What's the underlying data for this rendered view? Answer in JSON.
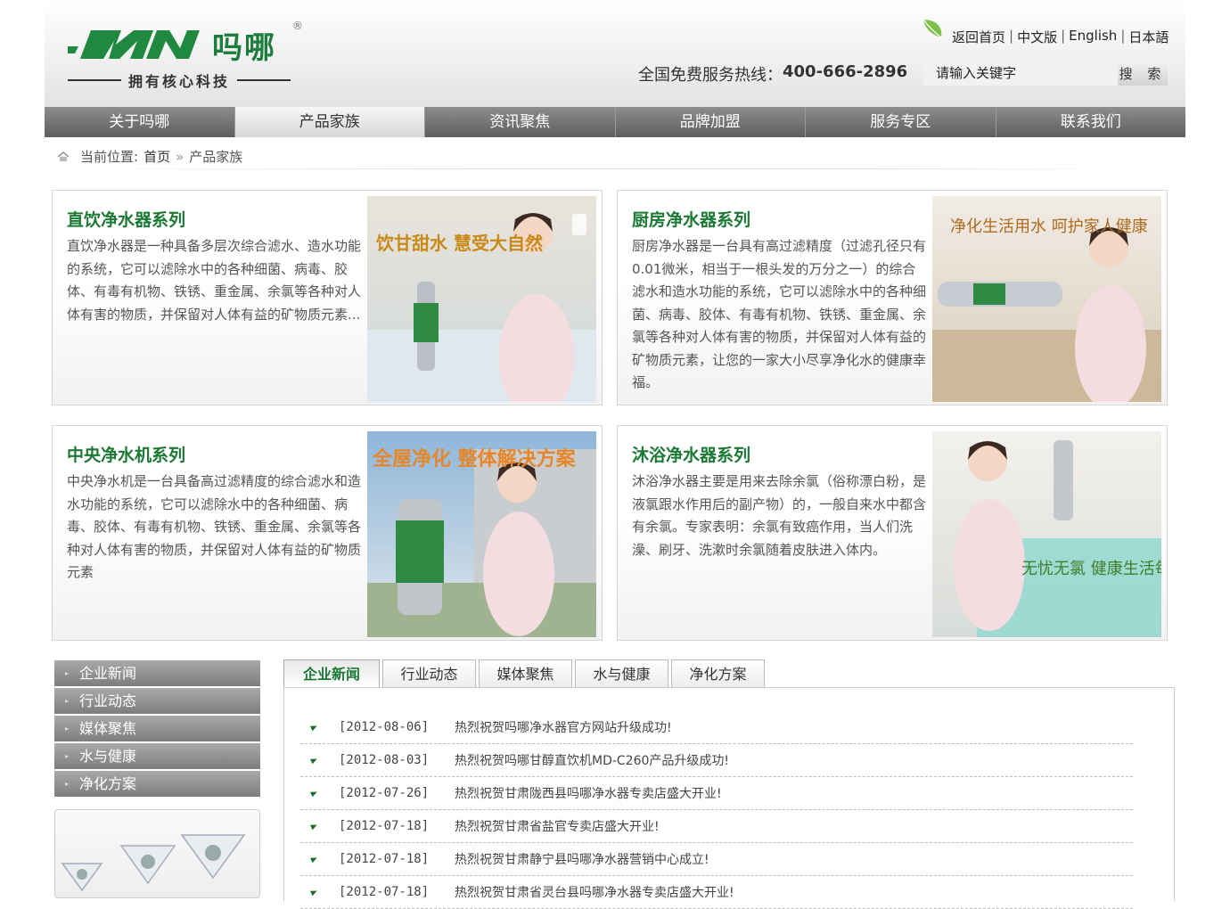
{
  "header": {
    "logo_cn": "吗哪",
    "logo_mark": "MN",
    "logo_reg": "®",
    "slogan": "拥有核心科技",
    "links": [
      "返回首页",
      "中文版",
      "English",
      "日本語"
    ],
    "hotline_label": "全国免费服务热线：",
    "hotline_number": "400-666-2896",
    "search_placeholder": "请输入关键字",
    "search_button": "搜 索"
  },
  "nav": [
    "关于吗哪",
    "产品家族",
    "资讯聚焦",
    "品牌加盟",
    "服务专区",
    "联系我们"
  ],
  "nav_active": 1,
  "breadcrumb": {
    "label": "当前位置:",
    "home": "首页",
    "separator": "»",
    "current": "产品家族"
  },
  "products": [
    {
      "title": "直饮净水器系列",
      "text": "直饮净水器是一种具备多层次综合滤水、造水功能的系统，它可以滤除水中的各种细菌、病毒、胶体、有毒有机物、铁锈、重金属、余氯等各种对人体有害的物质，并保留对人体有益的矿物质元素...",
      "img_text": "饮甘甜水 慧受大自然"
    },
    {
      "title": "厨房净水器系列",
      "text": "厨房净水器是一台具有高过滤精度（过滤孔径只有0.01微米，相当于一根头发的万分之一）的综合滤水和造水功能的系统，它可以滤除水中的各种细菌、病毒、胶体、有毒有机物、铁锈、重金属、余氯等各种对人体有害的物质，并保留对人体有益的矿物质元素，让您的一家大小尽享净化水的健康幸福。",
      "img_text": "净化生活用水 呵护家人健康"
    },
    {
      "title": "中央净水机系列",
      "text": "中央净水机是一台具备高过滤精度的综合滤水和造水功能的系统，它可以滤除水中的各种细菌、病毒、胶体、有毒有机物、铁锈、重金属、余氯等各种对人体有害的物质，并保留对人体有益的矿物质元素",
      "img_text": "全屋净化 整体解决方案"
    },
    {
      "title": "沐浴净水器系列",
      "text": "沐浴净水器主要是用来去除余氯（俗称漂白粉，是液氯跟水作用后的副产物）的，一般自来水中都含有余氯。专家表明：余氯有致癌作用，当人们洗澡、刷牙、洗漱时余氯随着皮肤进入体内。",
      "img_text": "无忧无氯 健康生活每一天！"
    }
  ],
  "side_menu": [
    "企业新闻",
    "行业动态",
    "媒体聚焦",
    "水与健康",
    "净化方案"
  ],
  "news_tabs": [
    "企业新闻",
    "行业动态",
    "媒体聚焦",
    "水与健康",
    "净化方案"
  ],
  "news_tab_active": 0,
  "news": [
    {
      "date": "[2012-08-06]",
      "title": "热烈祝贺吗哪净水器官方网站升级成功!"
    },
    {
      "date": "[2012-08-03]",
      "title": "热烈祝贺吗哪甘醇直饮机MD-C260产品升级成功!"
    },
    {
      "date": "[2012-07-26]",
      "title": "热烈祝贺甘肃陇西县吗哪净水器专卖店盛大开业!"
    },
    {
      "date": "[2012-07-18]",
      "title": "热烈祝贺甘肃省盐官专卖店盛大开业!"
    },
    {
      "date": "[2012-07-18]",
      "title": "热烈祝贺甘肃静宁县吗哪净水器营销中心成立!"
    },
    {
      "date": "[2012-07-18]",
      "title": "热烈祝贺甘肃省灵台县吗哪净水器专卖店盛大开业!"
    }
  ],
  "colors": {
    "brand_green": "#1a7a34",
    "nav_grey": "#6e6e6e"
  }
}
